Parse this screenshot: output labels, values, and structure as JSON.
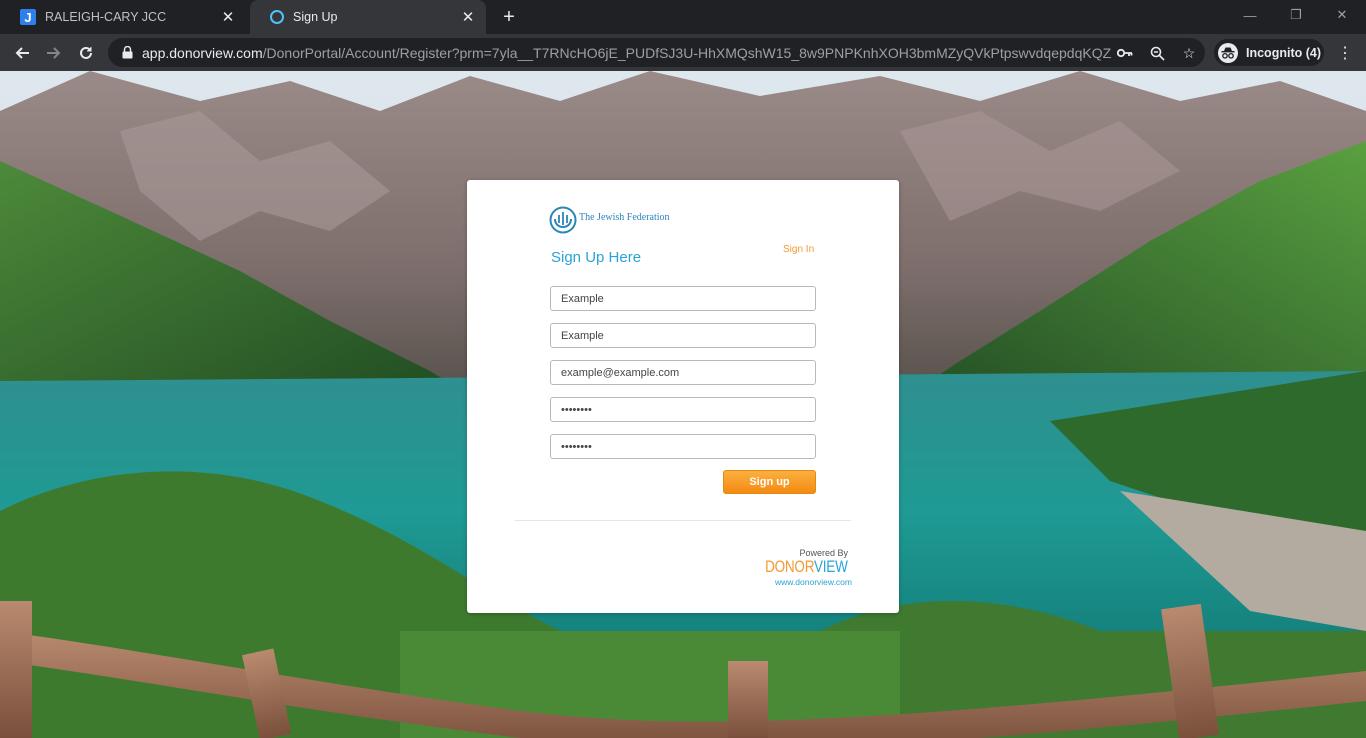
{
  "browser": {
    "tabs": [
      {
        "title": "RALEIGH-CARY JCC",
        "favicon_letter": "J",
        "active": false
      },
      {
        "title": "Sign Up",
        "active": true
      }
    ],
    "url_host": "app.donorview.com",
    "url_path": "/DonorPortal/Account/Register?prm=7yla__T7RNcHO6jE_PUDfSJ3U-HhXMQshW15_8w9PNPKnhXOH3bmMZyQVkPtpswvdqepdqKQZX...",
    "incognito_label": "Incognito (4)"
  },
  "card": {
    "org_name": "The Jewish Federation",
    "title": "Sign Up Here",
    "signin_link": "Sign In",
    "fields": {
      "first_name": "Example",
      "last_name": "Example",
      "email": "example@example.com",
      "password": "password",
      "confirm_password": "password"
    },
    "signup_button": "Sign up",
    "powered_by": "Powered By",
    "brand_part1": "DONOR",
    "brand_part2": "VIEW",
    "brand_url": "www.donorview.com"
  },
  "colors": {
    "accent_blue": "#2aa3d6",
    "accent_orange": "#f39a32"
  }
}
